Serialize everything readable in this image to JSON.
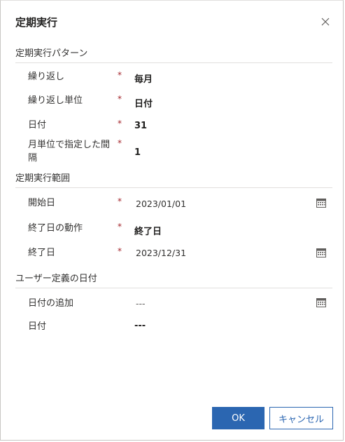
{
  "dialog": {
    "title": "定期実行",
    "close_icon": "close-icon"
  },
  "pattern_section": {
    "heading": "定期実行パターン",
    "fields": [
      {
        "label": "繰り返し",
        "required": "*",
        "value": "毎月"
      },
      {
        "label": "繰り返し単位",
        "required": "*",
        "value": "日付"
      },
      {
        "label": "日付",
        "required": "*",
        "value": "31"
      },
      {
        "label_line1": "月単位で指定した間",
        "label_line2": "隔",
        "required": "*",
        "value": "1"
      }
    ]
  },
  "range_section": {
    "heading": "定期実行範囲",
    "start": {
      "label": "開始日",
      "required": "*",
      "value": "2023/01/01",
      "icon": "calendar-icon"
    },
    "end_action": {
      "label": "終了日の動作",
      "required": "*",
      "value": "終了日"
    },
    "end": {
      "label": "終了日",
      "required": "*",
      "value": "2023/12/31",
      "icon": "calendar-icon"
    }
  },
  "custom_section": {
    "heading": "ユーザー定義の日付",
    "add_date": {
      "label": "日付の追加",
      "value": "---",
      "icon": "calendar-icon"
    },
    "date": {
      "label": "日付",
      "value": "---"
    }
  },
  "footer": {
    "ok_label": "OK",
    "cancel_label": "キャンセル"
  },
  "colors": {
    "primary": "#2b66b1",
    "required": "#a4262c",
    "divider": "#e1dfdd"
  }
}
